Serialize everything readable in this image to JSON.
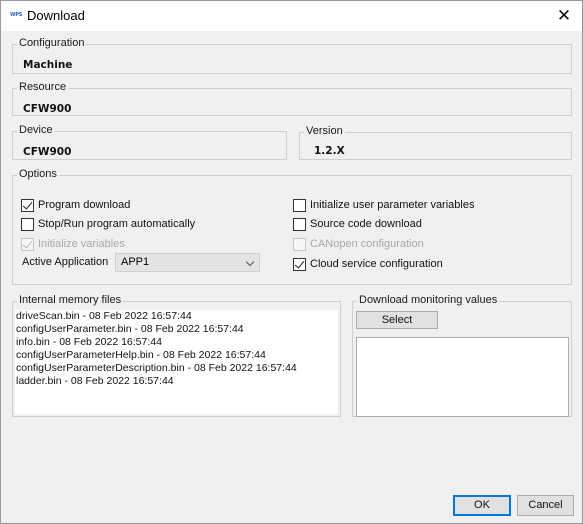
{
  "window": {
    "title": "Download",
    "app_icon_text": "WPS",
    "close_label": "✕"
  },
  "configuration": {
    "label": "Configuration",
    "value": "Machine"
  },
  "resource": {
    "label": "Resource",
    "value": "CFW900"
  },
  "device": {
    "label": "Device",
    "value": "CFW900"
  },
  "version": {
    "label": "Version",
    "value": "1.2.X"
  },
  "options": {
    "label": "Options",
    "program_download": {
      "label": "Program download",
      "checked": true,
      "enabled": true
    },
    "stop_run": {
      "label": "Stop/Run program automatically",
      "checked": false,
      "enabled": true
    },
    "initialize_variables": {
      "label": "Initialize variables",
      "checked": true,
      "enabled": false
    },
    "init_user_params": {
      "label": "Initialize user parameter variables",
      "checked": false,
      "enabled": true
    },
    "source_code_download": {
      "label": "Source code download",
      "checked": false,
      "enabled": true
    },
    "canopen_config": {
      "label": "CANopen configuration",
      "checked": false,
      "enabled": false
    },
    "cloud_service_config": {
      "label": "Cloud service configuration",
      "checked": true,
      "enabled": true
    },
    "active_application": {
      "label": "Active Application",
      "value": "APP1"
    }
  },
  "memory_files": {
    "label": "Internal memory files",
    "items": [
      "driveScan.bin - 08 Feb 2022 16:57:44",
      "configUserParameter.bin - 08 Feb 2022 16:57:44",
      "info.bin - 08 Feb 2022 16:57:44",
      "configUserParameterHelp.bin - 08 Feb 2022 16:57:44",
      "configUserParameterDescription.bin - 08 Feb 2022 16:57:44",
      "ladder.bin - 08 Feb 2022 16:57:44"
    ]
  },
  "monitoring": {
    "label": "Download monitoring values",
    "select_label": "Select"
  },
  "buttons": {
    "ok": "OK",
    "cancel": "Cancel"
  }
}
